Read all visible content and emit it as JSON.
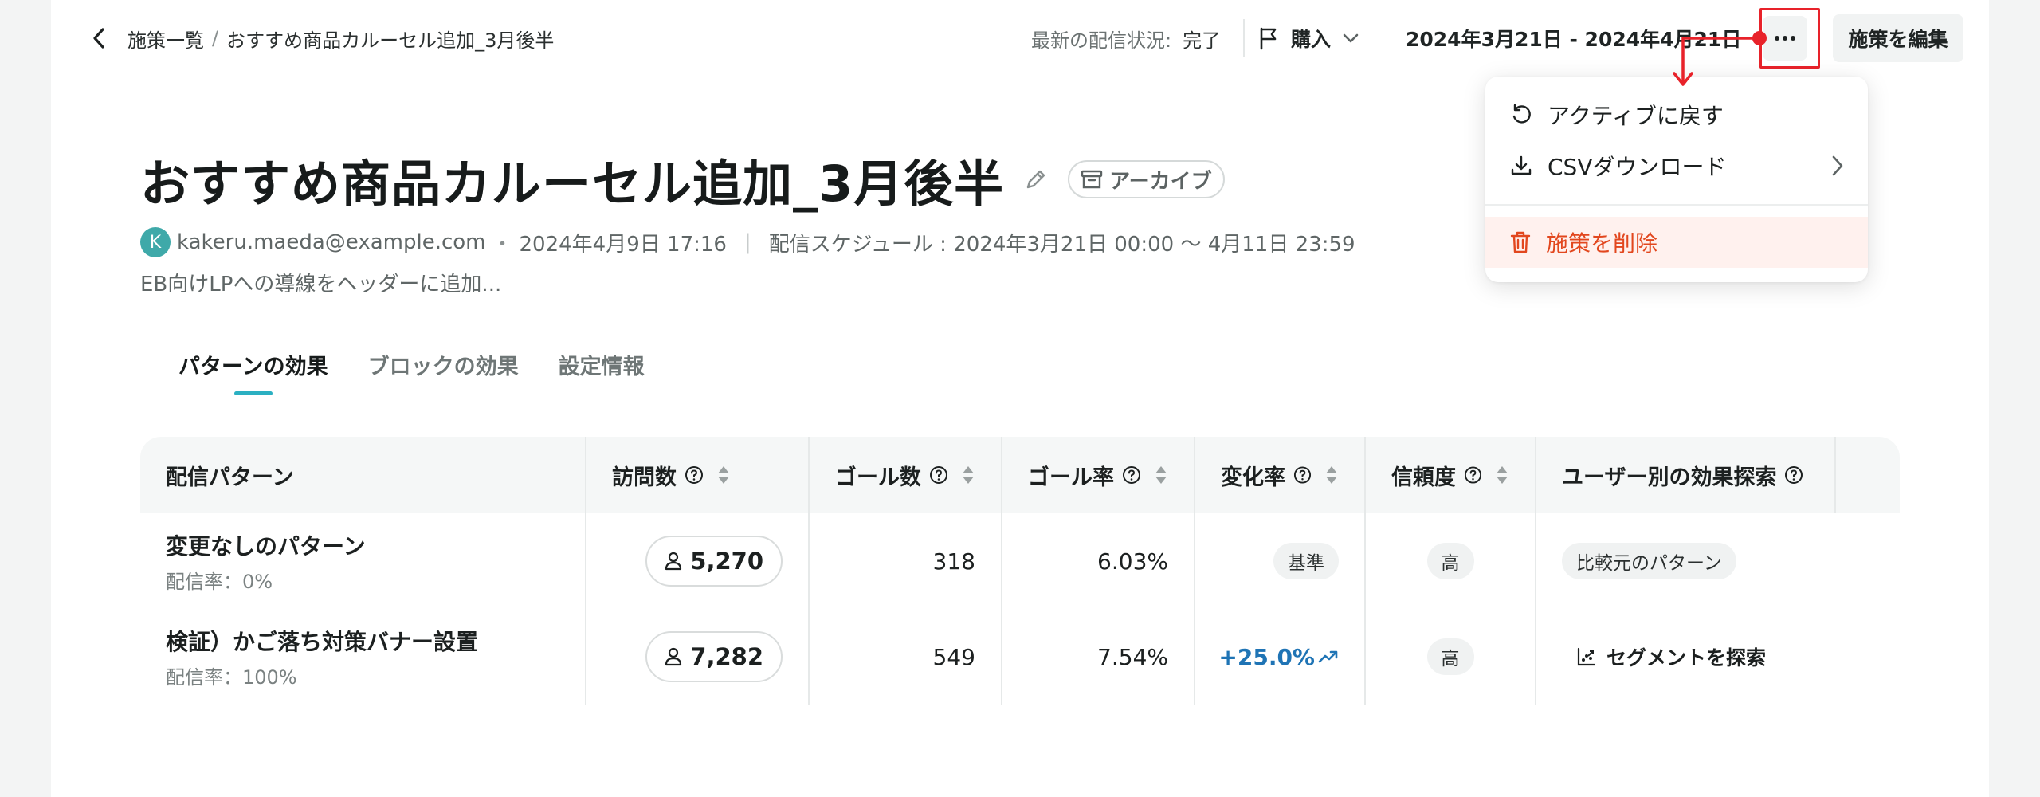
{
  "breadcrumb": {
    "parent": "施策一覧",
    "separator": "/",
    "current": "おすすめ商品カルーセル追加_3月後半"
  },
  "status": {
    "label": "最新の配信状況:",
    "value": "完了"
  },
  "goal_select": {
    "label": "購入"
  },
  "date_range": {
    "label": "2024年3月21日 - 2024年4月21日"
  },
  "actions": {
    "edit_label": "施策を編集",
    "more_icon": "ellipsis-icon"
  },
  "header": {
    "title": "おすすめ商品カルーセル追加_3月後半",
    "badge": "アーカイブ",
    "avatar_initial": "K",
    "author": "kakeru.maeda@example.com",
    "dot": "・",
    "created": "2024年4月9日 17:16",
    "schedule": "配信スケジュール : 2024年3月21日 00:00 〜 4月11日 23:59",
    "description": "EB向けLPへの導線をヘッダーに追加..."
  },
  "tabs": [
    {
      "label": "パターンの効果",
      "active": true
    },
    {
      "label": "ブロックの効果",
      "active": false
    },
    {
      "label": "設定情報",
      "active": false
    }
  ],
  "table": {
    "headers": [
      "配信パターン",
      "訪問数",
      "ゴール数",
      "ゴール率",
      "変化率",
      "信頼度",
      "ユーザー別の効果探索"
    ],
    "rows": [
      {
        "name": "変更なしのパターン",
        "rate": "配信率：0%",
        "visits": "5,270",
        "goals": "318",
        "goal_rate": "6.03%",
        "change": "基準",
        "confidence": "高",
        "explore": "比較元のパターン"
      },
      {
        "name": "検証）かご落ち対策バナー設置",
        "rate": "配信率：100%",
        "visits": "7,282",
        "goals": "549",
        "goal_rate": "7.54%",
        "change": "+25.0%",
        "confidence": "高",
        "explore": "セグメントを探索"
      }
    ]
  },
  "menu": {
    "items": [
      {
        "label": "アクティブに戻す",
        "icon": "undo-icon"
      },
      {
        "label": "CSVダウンロード",
        "icon": "download-icon"
      },
      {
        "label": "施策を削除",
        "icon": "trash-icon"
      }
    ]
  },
  "colors": {
    "accent": "#2bb0c2",
    "danger": "#e2471e",
    "annotation": "#e8222a",
    "positive": "#1f74b5"
  }
}
